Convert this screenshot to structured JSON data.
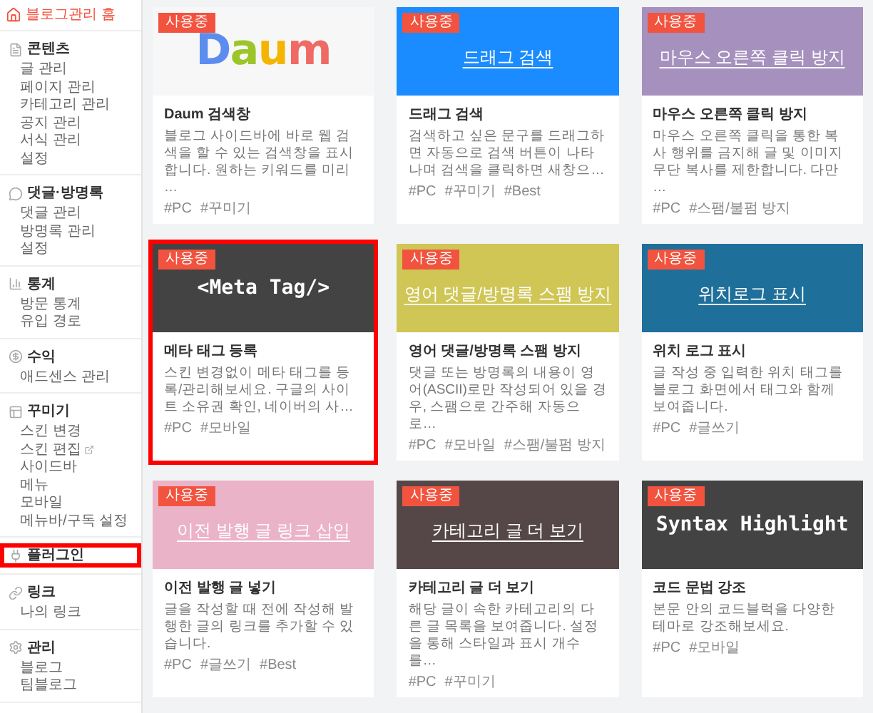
{
  "sidebar": {
    "home": {
      "label": "블로그관리 홈"
    },
    "sections": [
      {
        "title": "콘텐츠",
        "highlighted": false,
        "items": [
          {
            "label": "글 관리",
            "external": false
          },
          {
            "label": "페이지 관리",
            "external": false
          },
          {
            "label": "카테고리 관리",
            "external": false
          },
          {
            "label": "공지 관리",
            "external": false
          },
          {
            "label": "서식 관리",
            "external": false
          },
          {
            "label": "설정",
            "external": false
          }
        ]
      },
      {
        "title": "댓글·방명록",
        "highlighted": false,
        "items": [
          {
            "label": "댓글 관리",
            "external": false
          },
          {
            "label": "방명록 관리",
            "external": false
          },
          {
            "label": "설정",
            "external": false
          }
        ]
      },
      {
        "title": "통계",
        "highlighted": false,
        "items": [
          {
            "label": "방문 통계",
            "external": false
          },
          {
            "label": "유입 경로",
            "external": false
          }
        ]
      },
      {
        "title": "수익",
        "highlighted": false,
        "items": [
          {
            "label": "애드센스 관리",
            "external": false
          }
        ]
      },
      {
        "title": "꾸미기",
        "highlighted": false,
        "items": [
          {
            "label": "스킨 변경",
            "external": false
          },
          {
            "label": "스킨 편집",
            "external": true
          },
          {
            "label": "사이드바",
            "external": false
          },
          {
            "label": "메뉴",
            "external": false
          },
          {
            "label": "모바일",
            "external": false
          },
          {
            "label": "메뉴바/구독 설정",
            "external": false
          }
        ]
      },
      {
        "title": "플러그인",
        "highlighted": true
      },
      {
        "title": "링크",
        "highlighted": false,
        "items": [
          {
            "label": "나의 링크",
            "external": false
          }
        ]
      },
      {
        "title": "관리",
        "highlighted": false,
        "items": [
          {
            "label": "블로그",
            "external": false
          },
          {
            "label": "팀블로그",
            "external": false
          }
        ]
      }
    ]
  },
  "plugins": [
    {
      "badge": "사용중",
      "highlighted": false,
      "thumbnail": {
        "kind": "logo",
        "text": "Daum",
        "color": "#f7f7f7"
      },
      "title": "Daum 검색창",
      "description": "블로그 사이드바에 바로 웹 검색을 할 수 있는 검색창을 표시합니다. 원하는 키워드를 미리 …",
      "tags": [
        "#PC",
        "#꾸미기"
      ]
    },
    {
      "badge": "사용중",
      "highlighted": false,
      "thumbnail": {
        "kind": "banner",
        "text": "드래그 검색",
        "color": "#1a8cff"
      },
      "title": "드래그 검색",
      "description": "검색하고 싶은 문구를 드래그하면 자동으로 검색 버튼이 나타나며 검색을 클릭하면 새창으…",
      "tags": [
        "#PC",
        "#꾸미기",
        "#Best"
      ]
    },
    {
      "badge": "사용중",
      "highlighted": false,
      "thumbnail": {
        "kind": "banner",
        "text": "마우스 오른쪽 클릭 방지",
        "color": "#a690bd"
      },
      "title": "마우스 오른쪽 클릭 방지",
      "description": "마우스 오른쪽 클릭을 통한 복사 행위를 금지해 글 및 이미지 무단 복사를 제한합니다. 다만 …",
      "tags": [
        "#PC",
        "#스팸/불펌 방지"
      ]
    },
    {
      "badge": "사용중",
      "highlighted": true,
      "thumbnail": {
        "kind": "code",
        "text": "<Meta Tag/>",
        "color": "#434343"
      },
      "title": "메타 태그 등록",
      "description": "스킨 변경없이 메타 태그를 등록/관리해보세요. 구글의 사이트 소유권 확인, 네이버의 사…",
      "tags": [
        "#PC",
        "#모바일"
      ]
    },
    {
      "badge": "사용중",
      "highlighted": false,
      "thumbnail": {
        "kind": "banner",
        "text": "영어 댓글/방명록 스팸 방지",
        "color": "#cfc655"
      },
      "title": "영어 댓글/방명록 스팸 방지",
      "description": "댓글 또는 방명록의 내용이 영어(ASCII)로만 작성되어 있을 경우, 스팸으로 간주해 자동으로…",
      "tags": [
        "#PC",
        "#모바일",
        "#스팸/불펌 방지"
      ]
    },
    {
      "badge": "사용중",
      "highlighted": false,
      "thumbnail": {
        "kind": "banner",
        "text": "위치로그 표시",
        "color": "#1f6f9b"
      },
      "title": "위치 로그 표시",
      "description": "글 작성 중 입력한 위치 태그를 블로그 화면에서 태그와 함께 보여줍니다.",
      "tags": [
        "#PC",
        "#글쓰기"
      ]
    },
    {
      "badge": "사용중",
      "highlighted": false,
      "thumbnail": {
        "kind": "banner",
        "text": "이전 발행 글 링크 삽입",
        "color": "#ebb3c8"
      },
      "title": "이전 발행 글 넣기",
      "description": "글을 작성할 때 전에 작성해 발행한 글의 링크를 추가할 수 있습니다.",
      "tags": [
        "#PC",
        "#글쓰기",
        "#Best"
      ]
    },
    {
      "badge": "사용중",
      "highlighted": false,
      "thumbnail": {
        "kind": "banner",
        "text": "카테고리 글 더 보기",
        "color": "#554747"
      },
      "title": "카테고리 글 더 보기",
      "description": "해당 글이 속한 카테고리의 다른 글 목록을 보여줍니다. 설정을 통해 스타일과 표시 개수를…",
      "tags": [
        "#PC",
        "#꾸미기"
      ]
    },
    {
      "badge": "사용중",
      "highlighted": false,
      "thumbnail": {
        "kind": "code",
        "text": "Syntax Highlight",
        "color": "#434343"
      },
      "title": "코드 문법 강조",
      "description": "본문 안의 코드블럭을 다양한 테마로 강조해보세요.",
      "tags": [
        "#PC",
        "#모바일"
      ]
    }
  ]
}
